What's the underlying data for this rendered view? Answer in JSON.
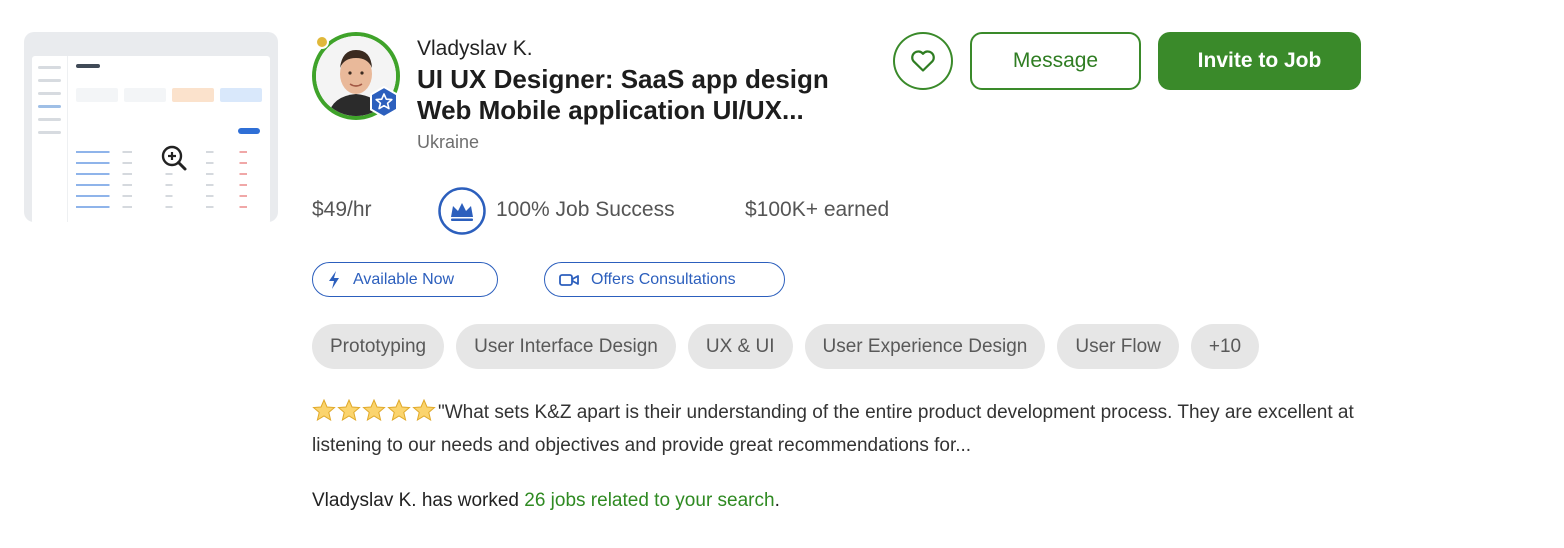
{
  "freelancer": {
    "name": "Vladyslav K.",
    "title": "UI UX Designer: SaaS app design Web Mobile application UI/UX...",
    "location": "Ukraine",
    "hourly_rate": "$49/hr",
    "job_success": "100% Job Success",
    "earned": "$100K+ earned"
  },
  "actions": {
    "save_icon": "heart-icon",
    "message_label": "Message",
    "invite_label": "Invite to Job"
  },
  "badges": {
    "available_label": "Available Now",
    "available_icon": "lightning-icon",
    "consult_label": "Offers Consultations",
    "consult_icon": "video-icon"
  },
  "skills": [
    "Prototyping",
    "User Interface Design",
    "UX & UI",
    "User Experience Design",
    "User Flow",
    "+10"
  ],
  "review": {
    "rating": 5,
    "text": "\"What sets K&Z apart is their understanding of the entire product development process. They are excellent at listening to our needs and objectives and provide great recommendations for..."
  },
  "jobs_line": {
    "prefix": "Vladyslav K. has worked ",
    "link": "26 jobs related to your search",
    "suffix": "."
  },
  "colors": {
    "brand_green": "#3a8a2a",
    "badge_blue": "#2c5fbd",
    "status_dot": "#e0b83a"
  }
}
